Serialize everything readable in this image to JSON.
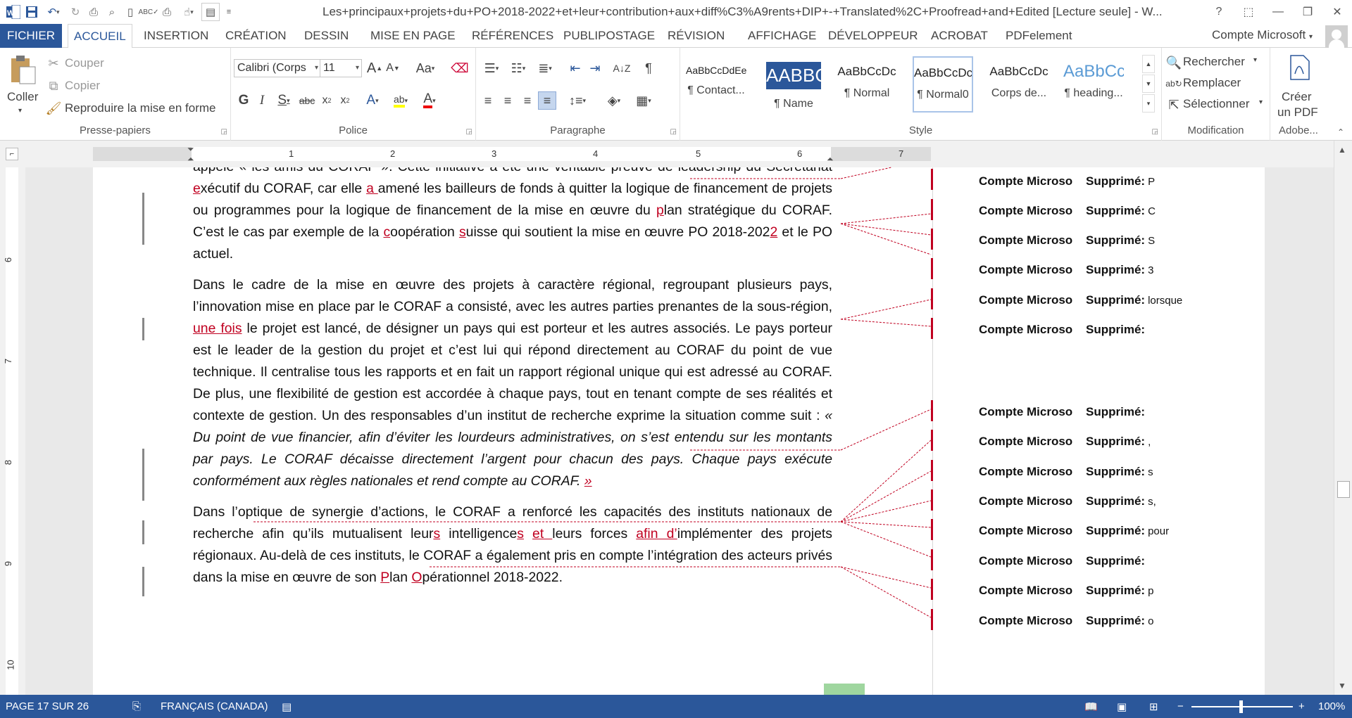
{
  "window": {
    "title": "Les+principaux+projets+du+PO+2018-2022+et+leur+contribution+aux+diff%C3%A9rents+DIP+-+Translated%2C+Proofread+and+Edited [Lecture seule] - W...",
    "help": "?",
    "restore_ribbon": "⬚",
    "minimize": "—",
    "maximize": "❐",
    "close": "✕"
  },
  "tabs": [
    {
      "label": "FICHIER"
    },
    {
      "label": "ACCUEIL"
    },
    {
      "label": "INSERTION"
    },
    {
      "label": "CRÉATION"
    },
    {
      "label": "DESSIN"
    },
    {
      "label": "MISE EN PAGE"
    },
    {
      "label": "RÉFÉRENCES"
    },
    {
      "label": "PUBLIPOSTAGE"
    },
    {
      "label": "RÉVISION"
    },
    {
      "label": "AFFICHAGE"
    },
    {
      "label": "DÉVELOPPEUR"
    },
    {
      "label": "ACROBAT"
    },
    {
      "label": "PDFelement"
    }
  ],
  "account": "Compte Microsoft",
  "ribbon": {
    "clipboard": {
      "label": "Presse-papiers",
      "paste": "Coller",
      "cut": "Couper",
      "copy": "Copier",
      "format_painter": "Reproduire la mise en forme"
    },
    "font": {
      "label": "Police",
      "font_name": "Calibri (Corps",
      "font_size": "11"
    },
    "paragraph": {
      "label": "Paragraphe"
    },
    "styles": {
      "label": "Style",
      "items": [
        {
          "preview": "AaBbCcDdEe",
          "name": "¶ Contact..."
        },
        {
          "preview": "AABBC",
          "name": "¶ Name"
        },
        {
          "preview": "AaBbCcDc",
          "name": "¶ Normal"
        },
        {
          "preview": "AaBbCcDc",
          "name": "¶ Normal0"
        },
        {
          "preview": "AaBbCcDc",
          "name": "Corps de..."
        },
        {
          "preview": "AaBbCc",
          "name": "¶ heading..."
        }
      ]
    },
    "editing": {
      "label": "Modification",
      "find": "Rechercher",
      "replace": "Remplacer",
      "select": "Sélectionner"
    },
    "adobe": {
      "label": "Adobe...",
      "create_pdf_1": "Créer",
      "create_pdf_2": "un PDF"
    }
  },
  "ruler": {
    "numbers": [
      "1",
      "2",
      "3",
      "4",
      "5",
      "6",
      "7"
    ],
    "vnumbers": [
      "6",
      "7",
      "8",
      "9",
      "10"
    ]
  },
  "document": {
    "p1": {
      "a": "appelé « les amis du CORAF ». Cette initiative a été une véritable preuve de leadership du Secrétariat ",
      "b": "e",
      "c": "xécutif du CORAF, car elle ",
      "d": "a ",
      "e": "amené les bailleurs de fonds à quitter la logique de financement de projets ou programmes pour la logique de financement de la mise en œuvre du ",
      "f": "p",
      "g": "lan stratégique du CORAF. C’est le cas par exemple de la ",
      "h": "c",
      "i": "oopération ",
      "j": "s",
      "k": "uisse qui soutient la mise en œuvre PO 2018-202",
      "l": "2",
      "m": " et le PO actuel."
    },
    "p2": {
      "a": "Dans le cadre de la mise en œuvre des projets à caractère régional, regroupant plusieurs pays, l’innovation mise en place par le CORAF a consisté, avec les autres parties prenantes de la sous-région, ",
      "b": "une fois",
      "c": " le projet est lancé, de désigner un pays qui est porteur et les autres associés. Le pays porteur est le leader de la gestion du projet et c’est lui qui répond directement au CORAF du point de vue technique. Il centralise tous les rapports et en fait un rapport régional unique qui est adressé au CORAF. De plus, une flexibilité de gestion est accordée à chaque pays, tout en tenant compte de ses réalités et contexte de gestion. Un des responsables d’un institut de recherche exprime la situation comme suit : ",
      "d": "« Du point de vue financier, afin d’éviter les lourdeurs administratives, on s’est entendu sur les montants par pays. Le CORAF décaisse directement l’argent pour chacun des pays. Chaque pays exécute conformément aux règles nationales et rend compte au CORAF. ",
      "e": "»"
    },
    "p3": {
      "a": "Dans l’optique de synergie d’actions, le CORAF a renforcé les capacités des instituts nationaux de recherche afin qu’ils mutualisent leur",
      "b": "s",
      "c": " intelligence",
      "d": "s",
      "e": " ",
      "f": "et ",
      "g": "leurs forces ",
      "h": "afin d’",
      "i": "implémenter des projets régionaux. Au-delà de ces instituts, le CORAF a également pris en compte l’intégration des acteurs privés dans la mise en œuvre de son ",
      "j": "P",
      "k": "lan ",
      "l": "O",
      "m": "pérationnel 2018-2022."
    }
  },
  "comments": [
    {
      "author": "Compte Microso",
      "label": "Supprimé:",
      "text": "P"
    },
    {
      "author": "Compte Microso",
      "label": "Supprimé:",
      "text": "C"
    },
    {
      "author": "Compte Microso",
      "label": "Supprimé:",
      "text": "S"
    },
    {
      "author": "Compte Microso",
      "label": "Supprimé:",
      "text": "3"
    },
    {
      "author": "Compte Microso",
      "label": "Supprimé:",
      "text": "lorsque"
    },
    {
      "author": "Compte Microso",
      "label": "Supprimé:",
      "text": ""
    },
    {
      "author": "Compte Microso",
      "label": "Supprimé:",
      "text": ""
    },
    {
      "author": "Compte Microso",
      "label": "Supprimé:",
      "text": ","
    },
    {
      "author": "Compte Microso",
      "label": "Supprimé:",
      "text": "s"
    },
    {
      "author": "Compte Microso",
      "label": "Supprimé:",
      "text": "s,"
    },
    {
      "author": "Compte Microso",
      "label": "Supprimé:",
      "text": "pour"
    },
    {
      "author": "Compte Microso",
      "label": "Supprimé:",
      "text": ""
    },
    {
      "author": "Compte Microso",
      "label": "Supprimé:",
      "text": "p"
    },
    {
      "author": "Compte Microso",
      "label": "Supprimé:",
      "text": "o"
    }
  ],
  "statusbar": {
    "page": "PAGE 17 SUR 26",
    "language": "FRANÇAIS (CANADA)",
    "zoom": "100%",
    "zoom_minus": "−",
    "zoom_plus": "+"
  },
  "colors": {
    "accent": "#2b579a",
    "revision": "#c00020"
  }
}
